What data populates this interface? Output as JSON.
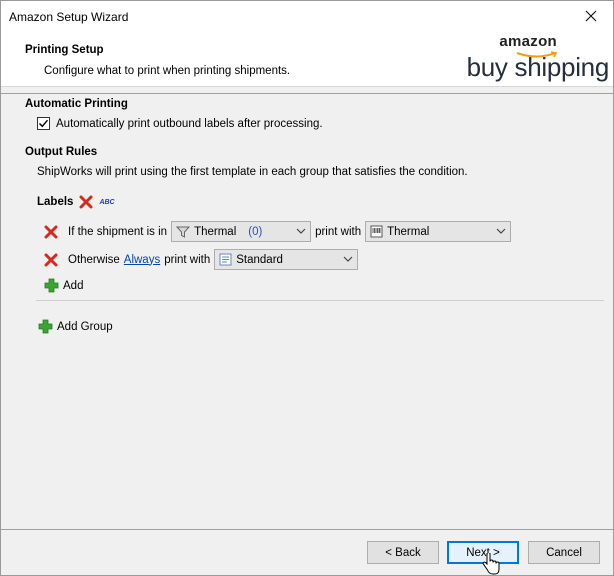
{
  "window": {
    "title": "Amazon Setup Wizard"
  },
  "header": {
    "title": "Printing Setup",
    "subtitle": "Configure what to print when printing shipments.",
    "logo_top": "amazon",
    "logo_bottom": "buy shipping"
  },
  "automatic_printing": {
    "title": "Automatic Printing",
    "checkbox_label": "Automatically print outbound labels after processing.",
    "checked": true
  },
  "output_rules": {
    "title": "Output Rules",
    "description": "ShipWorks will print using the first template in each group that satisfies the condition."
  },
  "labels_group": {
    "title": "Labels",
    "abc": "ABC",
    "rule1": {
      "prefix": "If the shipment is in",
      "filter_value": "Thermal",
      "filter_count": "(0)",
      "middle": "print with",
      "template_value": "Thermal"
    },
    "rule2": {
      "prefix": "Otherwise",
      "link": "Always",
      "middle": "print with",
      "template_value": "Standard"
    },
    "add_label": "Add"
  },
  "add_group_label": "Add Group",
  "footer": {
    "back_label": "< Back",
    "next_label": "Next >",
    "cancel_label": "Cancel"
  },
  "colors": {
    "accent": "#0078d7",
    "link": "#0645ad",
    "delete_red": "#d42a1e",
    "add_green": "#3ba534"
  }
}
